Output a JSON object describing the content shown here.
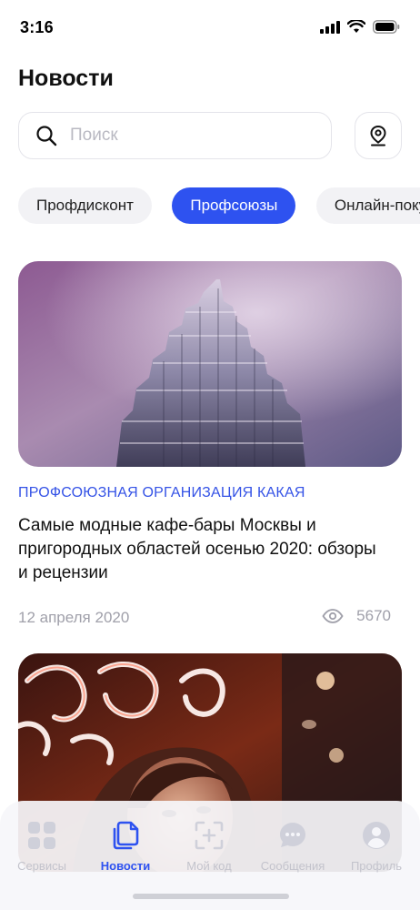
{
  "status": {
    "time": "3:16"
  },
  "header": {
    "title": "Новости"
  },
  "search": {
    "placeholder": "Поиск"
  },
  "chips": [
    "Профдисконт",
    "Профсоюзы",
    "Онлайн-покупки"
  ],
  "active_chip": "Профсоюзы",
  "cards": [
    {
      "category": "ПРОФСОЮЗНАЯ ОРГАНИЗАЦИЯ КАКАЯ",
      "title": "Самые модные кафе-бары Москвы и пригородных областей осенью 2020: обзоры и рецензии",
      "date": "12 апреля 2020",
      "views": "5670"
    }
  ],
  "tab_bar": {
    "items": [
      {
        "label": "Сервисы",
        "icon": "grid-icon"
      },
      {
        "label": "Новости",
        "icon": "documents-icon"
      },
      {
        "label": "Мой код",
        "icon": "qr-add-icon"
      },
      {
        "label": "Сообщения",
        "icon": "chat-icon"
      },
      {
        "label": "Профиль",
        "icon": "user-icon"
      }
    ],
    "active": "Новости"
  },
  "colors": {
    "accent": "#2e52f0",
    "category": "#3553e6",
    "muted": "#a0a0aa"
  }
}
